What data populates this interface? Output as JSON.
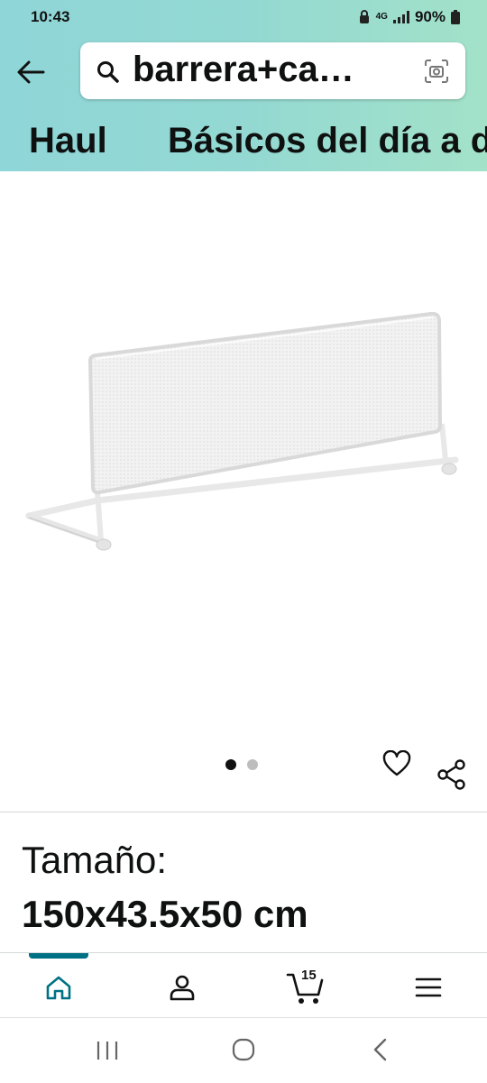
{
  "status_bar": {
    "time": "10:43",
    "network": "4G",
    "battery": "90%"
  },
  "search": {
    "query": "barrera+ca…"
  },
  "nav_links": [
    {
      "label": "Haul"
    },
    {
      "label": "Básicos del día a día"
    }
  ],
  "product": {
    "image_count": 2,
    "active_image_index": 0
  },
  "variation": {
    "label": "Tamaño:",
    "value": "150x43.5x50 cm"
  },
  "bottom_nav": {
    "items": [
      {
        "icon": "home-icon",
        "active": true
      },
      {
        "icon": "account-icon"
      },
      {
        "icon": "cart-icon",
        "count": "15"
      },
      {
        "icon": "menu-icon"
      }
    ]
  },
  "colors": {
    "header_gradient_start": "#8fd6d8",
    "header_gradient_end": "#a3e2c9",
    "accent": "#007185"
  }
}
